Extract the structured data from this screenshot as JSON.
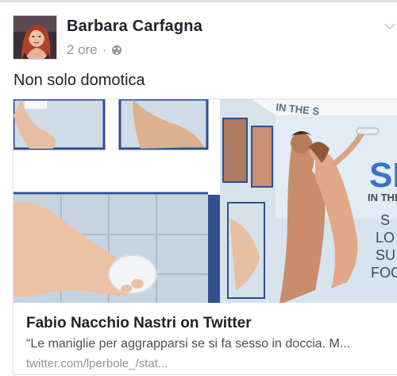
{
  "post": {
    "author": "Barbara Carfagna",
    "time": "2 ore",
    "separator": "·",
    "privacy_icon": "globe-icon",
    "menu_icon": "chevron-down-icon",
    "text": "Non solo domotica"
  },
  "link_card": {
    "title": "Fabio Nacchio Nastri on Twitter",
    "description": "“Le maniglie per aggrapparsi se si fa sesso in doccia. M...",
    "domain": "twitter.com/lperbole_/stat...",
    "image_text": {
      "box_top": "IN THE S",
      "box_logo": "SE",
      "box_sub": "IN THE S",
      "box_lines": [
        "S",
        "LO",
        "SU",
        "FOC"
      ]
    }
  },
  "colors": {
    "text": "#1d2129",
    "meta": "#90949c",
    "border": "#dddfe2",
    "tile_blue": "#2f4f8f"
  }
}
